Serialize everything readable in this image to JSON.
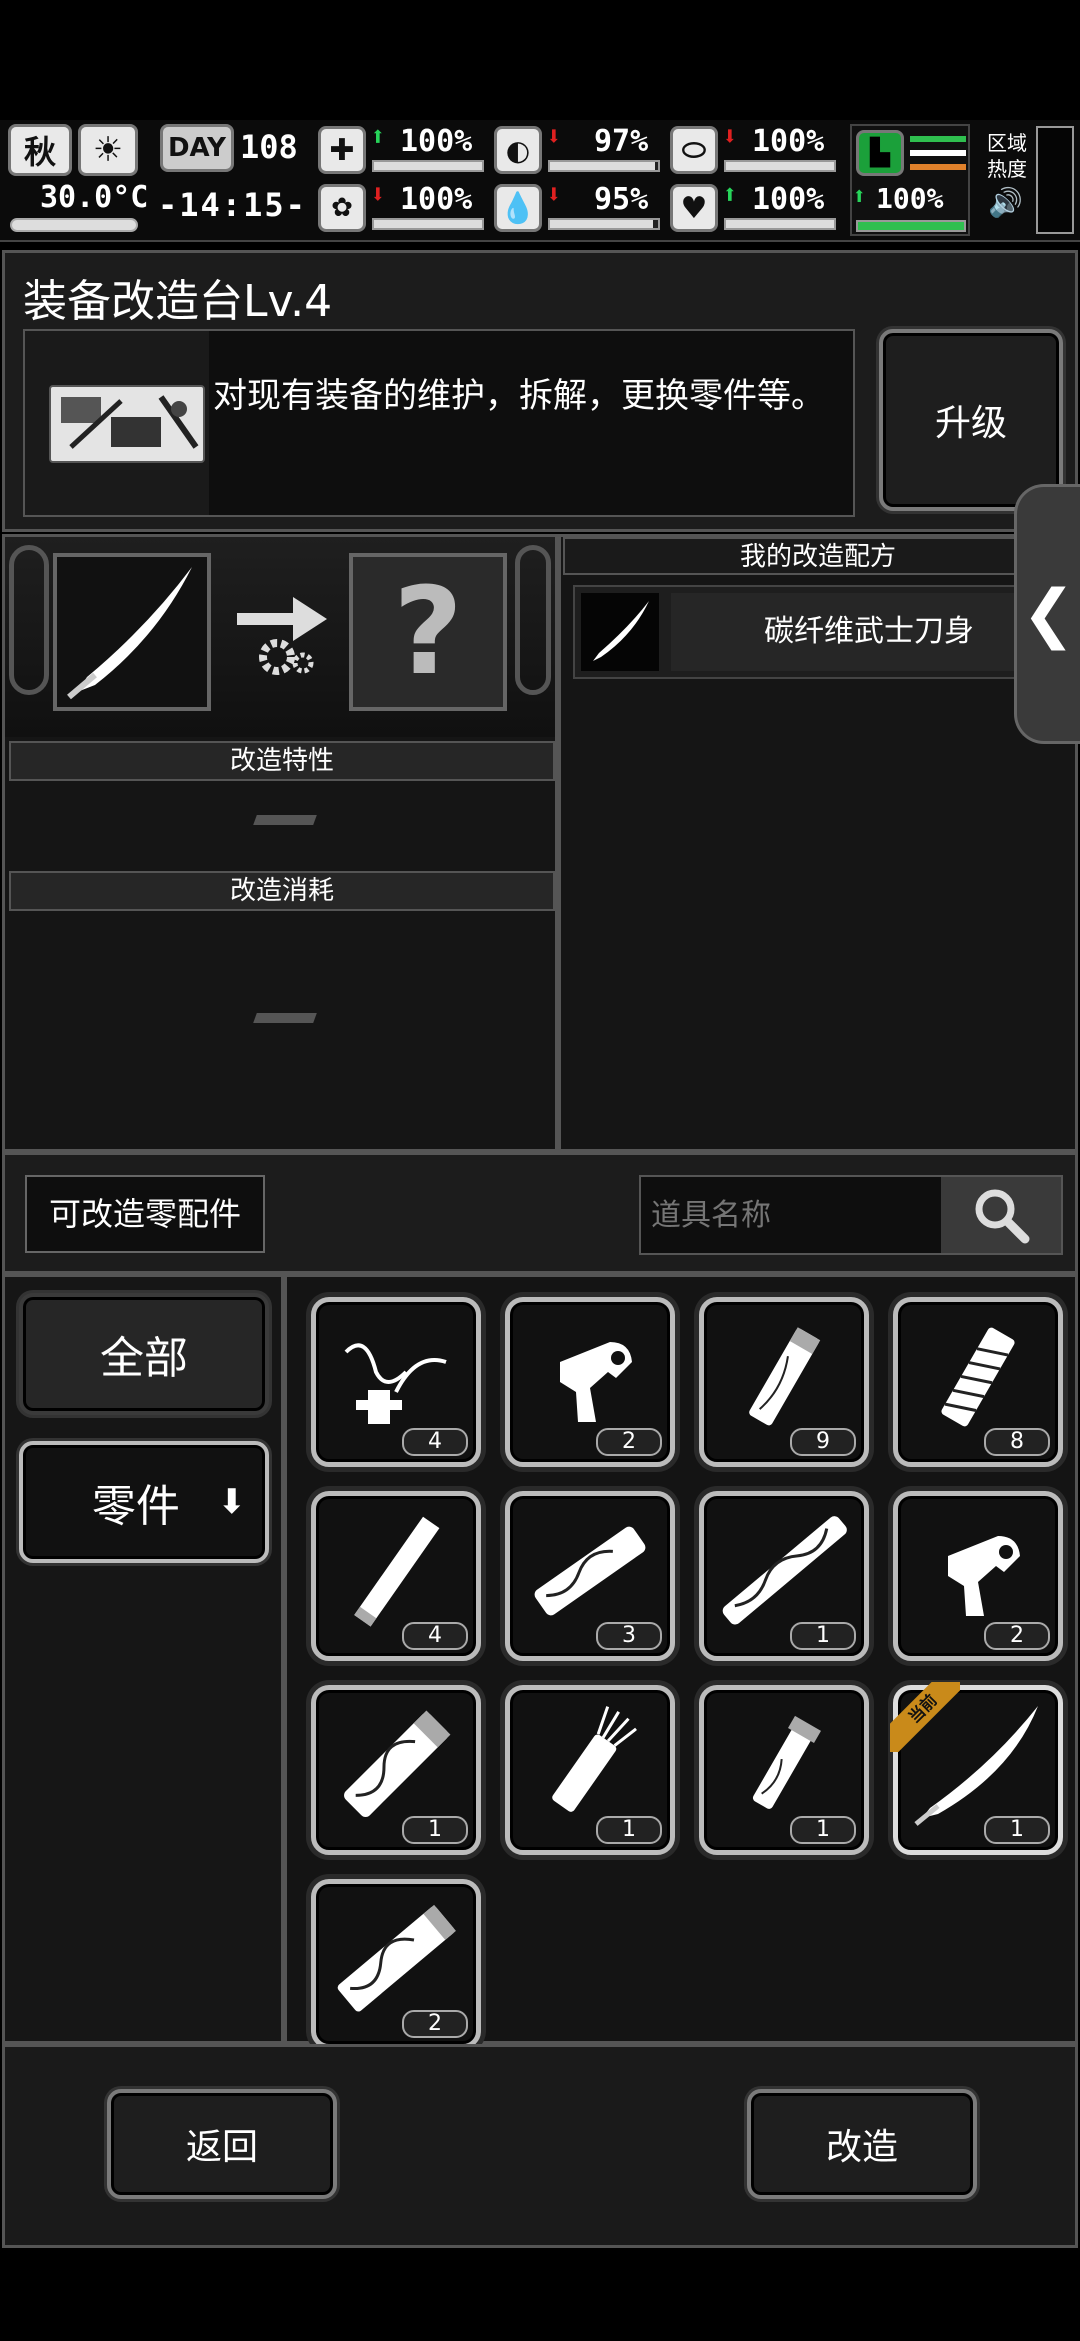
{
  "status": {
    "season": "秋",
    "temperature": "30.0°C",
    "day_label": "DAY",
    "day_number": "108",
    "time": "-14:15-",
    "stats": [
      {
        "name": "health",
        "icon": "medkit-icon",
        "trend": "up",
        "value": "100%",
        "level": 1.0
      },
      {
        "name": "hunger",
        "icon": "stomach-icon",
        "trend": "down",
        "value": "97%",
        "level": 0.97
      },
      {
        "name": "medicine",
        "icon": "pill-icon",
        "trend": "down",
        "value": "100%",
        "level": 1.0
      },
      {
        "name": "mind",
        "icon": "brain-icon",
        "trend": "down",
        "value": "100%",
        "level": 1.0
      },
      {
        "name": "thirst",
        "icon": "water-drop-icon",
        "trend": "down",
        "value": "95%",
        "level": 0.95
      },
      {
        "name": "mood",
        "icon": "heart-icon",
        "trend": "up",
        "value": "100%",
        "level": 1.0
      },
      {
        "name": "stamina",
        "icon": "boot-icon",
        "trend": "up",
        "value": "100%",
        "level": 1.0
      }
    ],
    "zone_heat_label": "区域\n热度"
  },
  "workbench": {
    "title": "装备改造台Lv.4",
    "description": "对现有装备的维护，拆解，更换零件等。",
    "upgrade_label": "升级"
  },
  "modify": {
    "unknown_symbol": "?",
    "traits_header": "改造特性",
    "cost_header": "改造消耗",
    "traits_value": "",
    "cost_value": ""
  },
  "recipes": {
    "header": "我的改造配方",
    "items": [
      {
        "label": "碳纤维武士刀身",
        "icon": "katana-icon"
      }
    ]
  },
  "parts": {
    "section_label": "可改造零配件",
    "search_placeholder": "道具名称",
    "filters": [
      {
        "label": "全部",
        "selected": true
      },
      {
        "label": "零件",
        "selected": false,
        "arrow": "⬇"
      }
    ],
    "current_tag": "当前",
    "items": [
      {
        "icon": "wire-trigger-icon",
        "count": "4"
      },
      {
        "icon": "hammer-trigger-icon",
        "count": "2"
      },
      {
        "icon": "wood-grip-icon",
        "count": "9"
      },
      {
        "icon": "wrapped-grip-icon",
        "count": "8"
      },
      {
        "icon": "steel-rod-icon",
        "count": "4"
      },
      {
        "icon": "patterned-handle-icon",
        "count": "3"
      },
      {
        "icon": "long-patterned-shaft-icon",
        "count": "1"
      },
      {
        "icon": "hammer-trigger-icon",
        "count": "2"
      },
      {
        "icon": "patterned-tube-icon",
        "count": "1"
      },
      {
        "icon": "frayed-grip-icon",
        "count": "1"
      },
      {
        "icon": "short-grip-icon",
        "count": "1"
      },
      {
        "icon": "katana-blade-icon",
        "count": "1",
        "current": true
      },
      {
        "icon": "patterned-bar-icon",
        "count": "2"
      }
    ]
  },
  "footer": {
    "back_label": "返回",
    "modify_label": "改造"
  }
}
